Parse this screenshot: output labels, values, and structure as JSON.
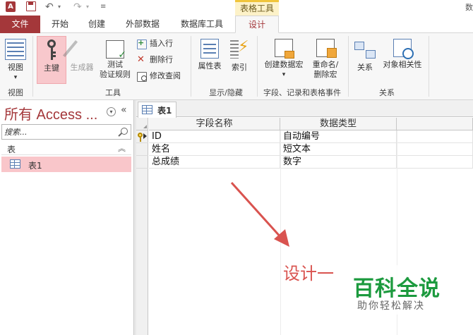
{
  "titlebar": {
    "context_tab": "表格工具",
    "edge_text": "数"
  },
  "tabs": {
    "file": "文件",
    "home": "开始",
    "create": "创建",
    "external": "外部数据",
    "dbtools": "数据库工具",
    "design": "设计"
  },
  "ribbon": {
    "groups": {
      "views": "视图",
      "tools": "工具",
      "show_hide": "显示/隐藏",
      "field_events": "字段、记录和表格事件",
      "relationships": "关系"
    },
    "buttons": {
      "view": "视图",
      "view_arrow": "▾",
      "primary_key": "主键",
      "builder": "生成器",
      "test_line1": "测试",
      "test_line2": "验证规则",
      "insert_rows": "插入行",
      "delete_rows": "删除行",
      "modify_lookups": "修改查阅",
      "property_sheet": "属性表",
      "indexes": "索引",
      "create_macro": "创建数据宏",
      "create_macro_arrow": "▾",
      "rename_line1": "重命名/",
      "rename_line2": "删除宏",
      "relationships": "关系",
      "object_dependencies": "对象相关性"
    }
  },
  "nav": {
    "title": "所有 Access ...",
    "search_placeholder": "搜索...",
    "category": "表",
    "items": [
      {
        "label": "表1"
      }
    ]
  },
  "document": {
    "tab_label": "表1",
    "columns": [
      "字段名称",
      "数据类型",
      ""
    ],
    "rows": [
      {
        "field": "ID",
        "type": "自动编号",
        "primary_key": true,
        "current": true
      },
      {
        "field": "姓名",
        "type": "短文本",
        "primary_key": false,
        "current": false
      },
      {
        "field": "总成绩",
        "type": "数字",
        "primary_key": false,
        "current": false
      }
    ]
  },
  "annotation": {
    "text": "设计一",
    "color": "#d9534f"
  },
  "watermark": {
    "title": "百科全说",
    "subtitle": "助你轻松解决"
  },
  "colors": {
    "accent": "#a4373a",
    "selected_nav": "#f9c6ca",
    "context_tab": "#fdf2c8",
    "watermark_green": "#1c9a3e"
  }
}
